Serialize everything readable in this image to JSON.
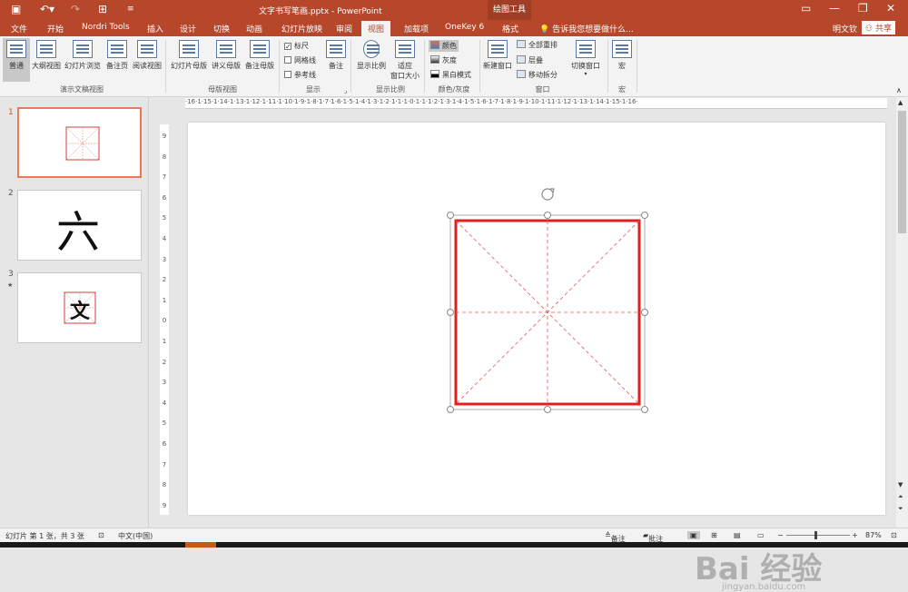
{
  "app": {
    "title": "文字书写笔画.pptx - PowerPoint",
    "context_tool": "绘图工具",
    "user": "明文钦",
    "share": "共享",
    "tell_me": "告诉我您想要做什么..."
  },
  "tabs": [
    "文件",
    "开始",
    "Nordri Tools",
    "插入",
    "设计",
    "切换",
    "动画",
    "幻灯片放映",
    "审阅",
    "视图",
    "加载项",
    "OneKey 6",
    "格式"
  ],
  "active_tab": "视图",
  "ribbon": {
    "presentation_views": [
      "普通",
      "大纲视图",
      "幻灯片浏览",
      "备注页",
      "阅读视图"
    ],
    "presentation_views_group": "演示文稿视图",
    "master_views": [
      "幻灯片母版",
      "讲义母版",
      "备注母版"
    ],
    "master_views_group": "母版视图",
    "show_checks": [
      "标尺",
      "网格线",
      "参考线"
    ],
    "notes": "备注",
    "show_group": "显示",
    "zoom_btn": "显示比例",
    "fit_btn": "适应\n窗口大小",
    "zoom_group": "显示比例",
    "color_options": [
      "颜色",
      "灰度",
      "黑白模式"
    ],
    "color_group": "颜色/灰度",
    "new_window": "新建窗口",
    "window_options": [
      "全部重排",
      "层叠",
      "移动拆分"
    ],
    "switch_window": "切换窗口",
    "window_group": "窗口",
    "macro": "宏",
    "macro_group": "宏"
  },
  "thumbnails": [
    {
      "num": "1",
      "star": ""
    },
    {
      "num": "2",
      "char": "六",
      "star": ""
    },
    {
      "num": "3",
      "char": "文",
      "star": "★"
    }
  ],
  "ruler_h": "·16·1·15·1·14·1·13·1·12·1·11·1·10·1·9·1·8·1·7·1·6·1·5·1·4·1·3·1·2·1·1·1·0·1·1·1·2·1·3·1·4·1·5·1·6·1·7·1·8·1·9·1·10·1·11·1·12·1·13·1·14·1·15·1·16·",
  "ruler_v": [
    "9",
    "8",
    "7",
    "6",
    "5",
    "4",
    "3",
    "2",
    "1",
    "0",
    "1",
    "2",
    "3",
    "4",
    "5",
    "6",
    "7",
    "8",
    "9"
  ],
  "status": {
    "slide_info": "幻灯片 第 1 张，共 3 张",
    "language": "中文(中国)",
    "notes": "备注",
    "comments": "批注",
    "zoom": "87%"
  },
  "watermark": {
    "main": "Bai 经验",
    "sub": "jingyan.baidu.com"
  }
}
